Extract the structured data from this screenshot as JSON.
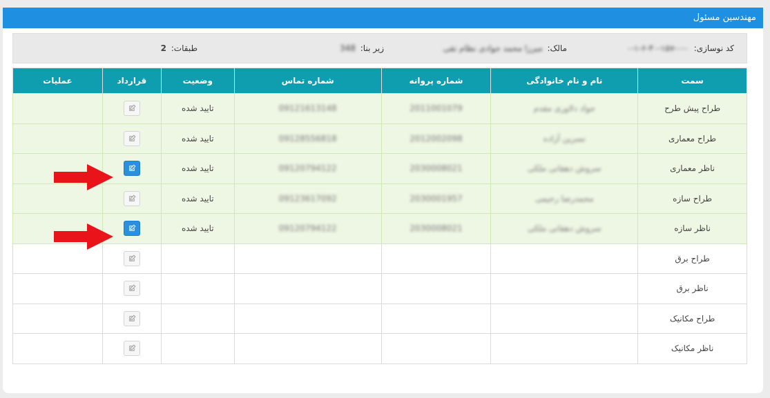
{
  "panel": {
    "title": "مهندسین مسئول"
  },
  "info": {
    "code_label": "کد نوسازی:",
    "code_value": "۰-۰-۱۵۷-۴۰-۶-۱-۰",
    "owner_label": "مالک:",
    "owner_value": "میرزا محمد جوادی نظام تقی",
    "area_label": "زیر بنا:",
    "area_value": "348",
    "floors_label": "طبقات:",
    "floors_value": "2"
  },
  "table": {
    "headers": {
      "role": "سمت",
      "name": "نام و نام خانوادگی",
      "license": "شماره پروانه",
      "phone": "شماره تماس",
      "status": "وضعیت",
      "contract": "قرارداد",
      "ops": "عملیات"
    },
    "rows": [
      {
        "role": "طراح پیش طرح",
        "name": "جواد دلاوری مقدم",
        "license": "2011001079",
        "phone": "09121613148",
        "status": "تایید شده"
      },
      {
        "role": "طراح معماری",
        "name": "نسرین آزاده",
        "license": "2012002098",
        "phone": "09128556818",
        "status": "تایید شده"
      },
      {
        "role": "ناظر معماری",
        "name": "سروش دهقانی ملکی",
        "license": "2030008021",
        "phone": "09120794122",
        "status": "تایید شده"
      },
      {
        "role": "طراح سازه",
        "name": "محمدرضا رحیمی",
        "license": "2030001957",
        "phone": "09123617092",
        "status": "تایید شده"
      },
      {
        "role": "ناظر سازه",
        "name": "سروش دهقانی ملکی",
        "license": "2030008021",
        "phone": "09120794122",
        "status": "تایید شده"
      },
      {
        "role": "طراح برق",
        "name": "",
        "license": "",
        "phone": "",
        "status": ""
      },
      {
        "role": "ناظر برق",
        "name": "",
        "license": "",
        "phone": "",
        "status": ""
      },
      {
        "role": "طراح مکانیک",
        "name": "",
        "license": "",
        "phone": "",
        "status": ""
      },
      {
        "role": "ناظر مکانیک",
        "name": "",
        "license": "",
        "phone": "",
        "status": ""
      }
    ]
  },
  "colors": {
    "header_bar": "#1e8fe1",
    "table_header": "#0e9eb0",
    "approved_row": "#eef7e4",
    "arrow": "#e8141a",
    "active_button": "#2b8fe0"
  },
  "icons": {
    "contract": "edit-icon",
    "pointer": "arrow-right-icon"
  }
}
